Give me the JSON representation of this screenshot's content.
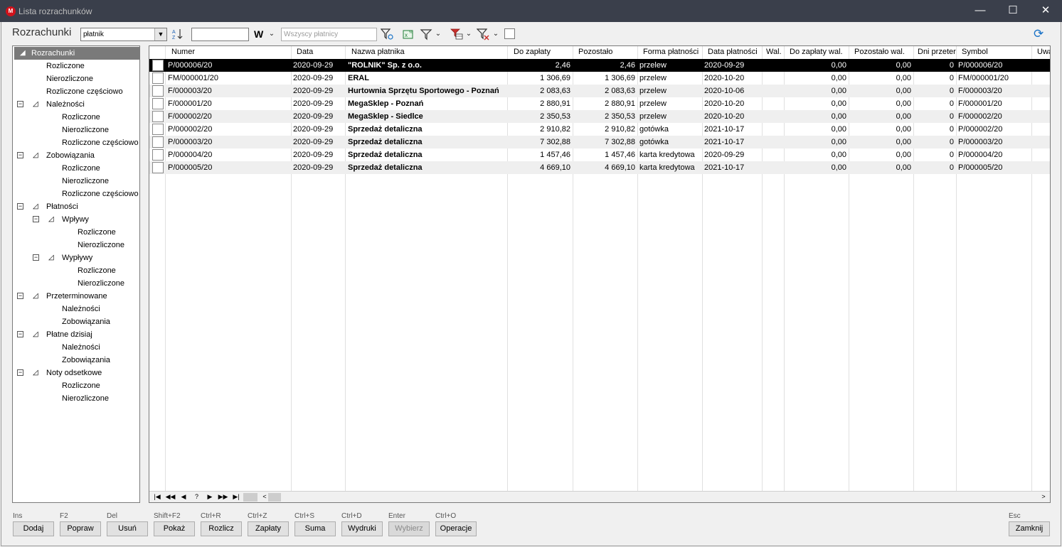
{
  "window": {
    "title": "Lista rozrachunków",
    "icon_letter": "M",
    "minimize": "—",
    "maximize": "☐",
    "close": "✕"
  },
  "toolbar": {
    "title": "Rozrachunki",
    "sort_combo_value": "płatnik",
    "w_label": "W",
    "payers_placeholder": "Wszyscy płatnicy"
  },
  "tree": {
    "root": "Rozrachunki",
    "items": [
      {
        "label": "Rozliczone",
        "level": 2
      },
      {
        "label": "Nierozliczone",
        "level": 2
      },
      {
        "label": "Rozliczone częściowo",
        "level": 2
      },
      {
        "label": "Należności",
        "level": 1,
        "group": true
      },
      {
        "label": "Rozliczone",
        "level": 3
      },
      {
        "label": "Nierozliczone",
        "level": 3
      },
      {
        "label": "Rozliczone częściowo",
        "level": 3
      },
      {
        "label": "Zobowiązania",
        "level": 1,
        "group": true
      },
      {
        "label": "Rozliczone",
        "level": 3
      },
      {
        "label": "Nierozliczone",
        "level": 3
      },
      {
        "label": "Rozliczone częściowo",
        "level": 3
      },
      {
        "label": "Płatności",
        "level": 1,
        "group": true
      },
      {
        "label": "Wpływy",
        "level": 2,
        "group": true
      },
      {
        "label": "Rozliczone",
        "level": 4
      },
      {
        "label": "Nierozliczone",
        "level": 4
      },
      {
        "label": "Wypływy",
        "level": 2,
        "group": true
      },
      {
        "label": "Rozliczone",
        "level": 4
      },
      {
        "label": "Nierozliczone",
        "level": 4
      },
      {
        "label": "Przeterminowane",
        "level": 1,
        "group": true
      },
      {
        "label": "Należności",
        "level": 3
      },
      {
        "label": "Zobowiązania",
        "level": 3
      },
      {
        "label": "Płatne dzisiaj",
        "level": 1,
        "group": true
      },
      {
        "label": "Należności",
        "level": 3
      },
      {
        "label": "Zobowiązania",
        "level": 3
      },
      {
        "label": "Noty odsetkowe",
        "level": 1,
        "group": true
      },
      {
        "label": "Rozliczone",
        "level": 3
      },
      {
        "label": "Nierozliczone",
        "level": 3
      }
    ]
  },
  "grid": {
    "columns": [
      "Numer",
      "Data",
      "Nazwa płatnika",
      "Do zapłaty",
      "Pozostało",
      "Forma płatności",
      "Data płatności",
      "Wal.",
      "Do zapłaty wal.",
      "Pozostało wal.",
      "Dni przeter",
      "Symbol",
      "Uwa"
    ],
    "rows": [
      [
        "P/000006/20",
        "2020-09-29",
        "\"ROLNIK\" Sp. z o.o.",
        "2,46",
        "2,46",
        "przelew",
        "2020-09-29",
        "",
        "0,00",
        "0,00",
        "0",
        "P/000006/20"
      ],
      [
        "FM/000001/20",
        "2020-09-29",
        "ERAL",
        "1 306,69",
        "1 306,69",
        "przelew",
        "2020-10-20",
        "",
        "0,00",
        "0,00",
        "0",
        "FM/000001/20"
      ],
      [
        "F/000003/20",
        "2020-09-29",
        "Hurtownia Sprzętu Sportowego - Poznań",
        "2 083,63",
        "2 083,63",
        "przelew",
        "2020-10-06",
        "",
        "0,00",
        "0,00",
        "0",
        "F/000003/20"
      ],
      [
        "F/000001/20",
        "2020-09-29",
        "MegaSklep - Poznań",
        "2 880,91",
        "2 880,91",
        "przelew",
        "2020-10-20",
        "",
        "0,00",
        "0,00",
        "0",
        "F/000001/20"
      ],
      [
        "F/000002/20",
        "2020-09-29",
        "MegaSklep - Siedlce",
        "2 350,53",
        "2 350,53",
        "przelew",
        "2020-10-20",
        "",
        "0,00",
        "0,00",
        "0",
        "F/000002/20"
      ],
      [
        "P/000002/20",
        "2020-09-29",
        "Sprzedaż detaliczna",
        "2 910,82",
        "2 910,82",
        "gotówka",
        "2021-10-17",
        "",
        "0,00",
        "0,00",
        "0",
        "P/000002/20"
      ],
      [
        "P/000003/20",
        "2020-09-29",
        "Sprzedaż detaliczna",
        "7 302,88",
        "7 302,88",
        "gotówka",
        "2021-10-17",
        "",
        "0,00",
        "0,00",
        "0",
        "P/000003/20"
      ],
      [
        "P/000004/20",
        "2020-09-29",
        "Sprzedaż detaliczna",
        "1 457,46",
        "1 457,46",
        "karta kredytowa",
        "2020-09-29",
        "",
        "0,00",
        "0,00",
        "0",
        "P/000004/20"
      ],
      [
        "P/000005/20",
        "2020-09-29",
        "Sprzedaż detaliczna",
        "4 669,10",
        "4 669,10",
        "karta kredytowa",
        "2021-10-17",
        "",
        "0,00",
        "0,00",
        "0",
        "P/000005/20"
      ]
    ],
    "selected_row": 0,
    "nav": [
      "|◀",
      "◀◀",
      "◀",
      "?",
      "▶",
      "▶▶",
      "▶|"
    ],
    "scroll_left": "<",
    "scroll_right": ">"
  },
  "buttons": [
    {
      "shortcut": "Ins",
      "label": "Dodaj",
      "enabled": true
    },
    {
      "shortcut": "F2",
      "label": "Popraw",
      "enabled": true
    },
    {
      "shortcut": "Del",
      "label": "Usuń",
      "enabled": true
    },
    {
      "shortcut": "Shift+F2",
      "label": "Pokaż",
      "enabled": true
    },
    {
      "shortcut": "Ctrl+R",
      "label": "Rozlicz",
      "enabled": true
    },
    {
      "shortcut": "Ctrl+Z",
      "label": "Zapłaty",
      "enabled": true
    },
    {
      "shortcut": "Ctrl+S",
      "label": "Suma",
      "enabled": true
    },
    {
      "shortcut": "Ctrl+D",
      "label": "Wydruki",
      "enabled": true
    },
    {
      "shortcut": "Enter",
      "label": "Wybierz",
      "enabled": false
    },
    {
      "shortcut": "Ctrl+O",
      "label": "Operacje",
      "enabled": true
    }
  ],
  "close_button": {
    "shortcut": "Esc",
    "label": "Zamknij"
  }
}
